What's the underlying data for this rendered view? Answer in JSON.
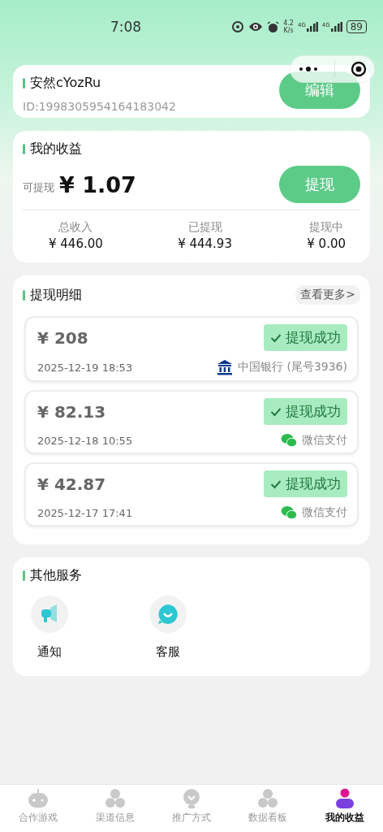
{
  "status_bar": {
    "time": "7:08",
    "speed_value": "4.2",
    "speed_unit": "K/s",
    "networks": [
      "4G",
      "4G"
    ],
    "battery": "89"
  },
  "profile": {
    "name": "安然cYozRu",
    "id": "ID:1998305954164183042",
    "edit_button": "编辑"
  },
  "earnings": {
    "title": "我的收益",
    "available_label": "可提现",
    "available_amount": "¥ 1.07",
    "withdraw_button": "提现",
    "stats": [
      {
        "label": "总收入",
        "value": "¥ 446.00"
      },
      {
        "label": "已提现",
        "value": "¥ 444.93"
      },
      {
        "label": "提现中",
        "value": "¥ 0.00"
      }
    ]
  },
  "withdrawals": {
    "title": "提现明细",
    "more_link": "查看更多>",
    "records": [
      {
        "amount": "¥ 208",
        "status": "提现成功",
        "time": "2025-12-19 18:53",
        "kind": "bank",
        "method": "中国银行 (尾号3936)"
      },
      {
        "amount": "¥ 82.13",
        "status": "提现成功",
        "time": "2025-12-18 10:55",
        "kind": "wechat",
        "method": "微信支付"
      },
      {
        "amount": "¥ 42.87",
        "status": "提现成功",
        "time": "2025-12-17 17:41",
        "kind": "wechat",
        "method": "微信支付"
      }
    ]
  },
  "services": {
    "title": "其他服务",
    "items": [
      {
        "kind": "notice",
        "label": "通知"
      },
      {
        "kind": "support",
        "label": "客服"
      }
    ]
  },
  "tab_bar": [
    {
      "kind": "gamepad",
      "label": "合作游戏",
      "selected": false
    },
    {
      "kind": "hexagons",
      "label": "渠道信息",
      "selected": false
    },
    {
      "kind": "bulb",
      "label": "推广方式",
      "selected": false
    },
    {
      "kind": "hexagons",
      "label": "数据看板",
      "selected": false
    },
    {
      "kind": "person",
      "label": "我的收益",
      "selected": true
    }
  ]
}
